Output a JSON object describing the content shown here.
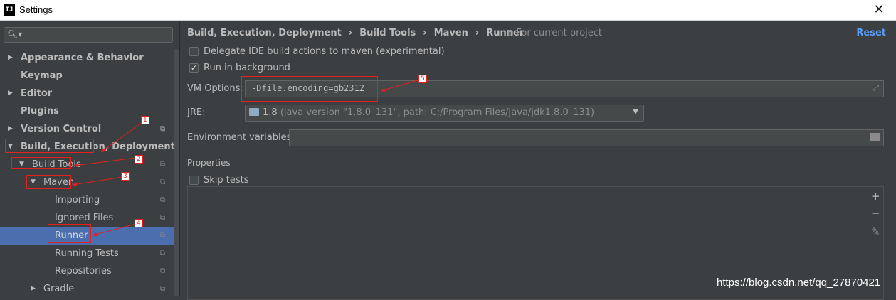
{
  "window": {
    "title": "Settings",
    "app_icon": "IJ"
  },
  "sidebar": {
    "items": [
      {
        "label": "Appearance & Behavior",
        "expanded": false
      },
      {
        "label": "Keymap"
      },
      {
        "label": "Editor",
        "expanded": false
      },
      {
        "label": "Plugins"
      },
      {
        "label": "Version Control",
        "expanded": false
      },
      {
        "label": "Build, Execution, Deployment",
        "expanded": true
      },
      {
        "label": "Build Tools",
        "expanded": true
      },
      {
        "label": "Maven",
        "expanded": true
      },
      {
        "label": "Importing"
      },
      {
        "label": "Ignored Files"
      },
      {
        "label": "Runner",
        "selected": true
      },
      {
        "label": "Running Tests"
      },
      {
        "label": "Repositories"
      },
      {
        "label": "Gradle",
        "expanded": false
      }
    ]
  },
  "breadcrumb": [
    "Build, Execution, Deployment",
    "Build Tools",
    "Maven",
    "Runner"
  ],
  "for_project": "For current project",
  "reset_label": "Reset",
  "options": {
    "delegate": {
      "label": "Delegate IDE build actions to maven (experimental)",
      "checked": false
    },
    "run_in_background": {
      "label": "Run in background",
      "checked": true
    },
    "vm_options": {
      "label": "VM Options:",
      "value": "-Dfile.encoding=gb2312"
    },
    "jre": {
      "label": "JRE:",
      "version": "1.8",
      "detail": "(java version \"1.8.0_131\", path: C:/Program Files/Java/jdk1.8.0_131)"
    },
    "env_vars": {
      "label": "Environment variables:",
      "value": ""
    },
    "properties_header": "Properties",
    "skip_tests": {
      "label": "Skip tests",
      "checked": false
    }
  },
  "annotations": [
    "1",
    "2",
    "3",
    "4",
    "5"
  ],
  "accent_color": "#4b6eaf",
  "annotation_color": "#e51e1e",
  "watermark": "https://blog.csdn.net/qq_27870421"
}
